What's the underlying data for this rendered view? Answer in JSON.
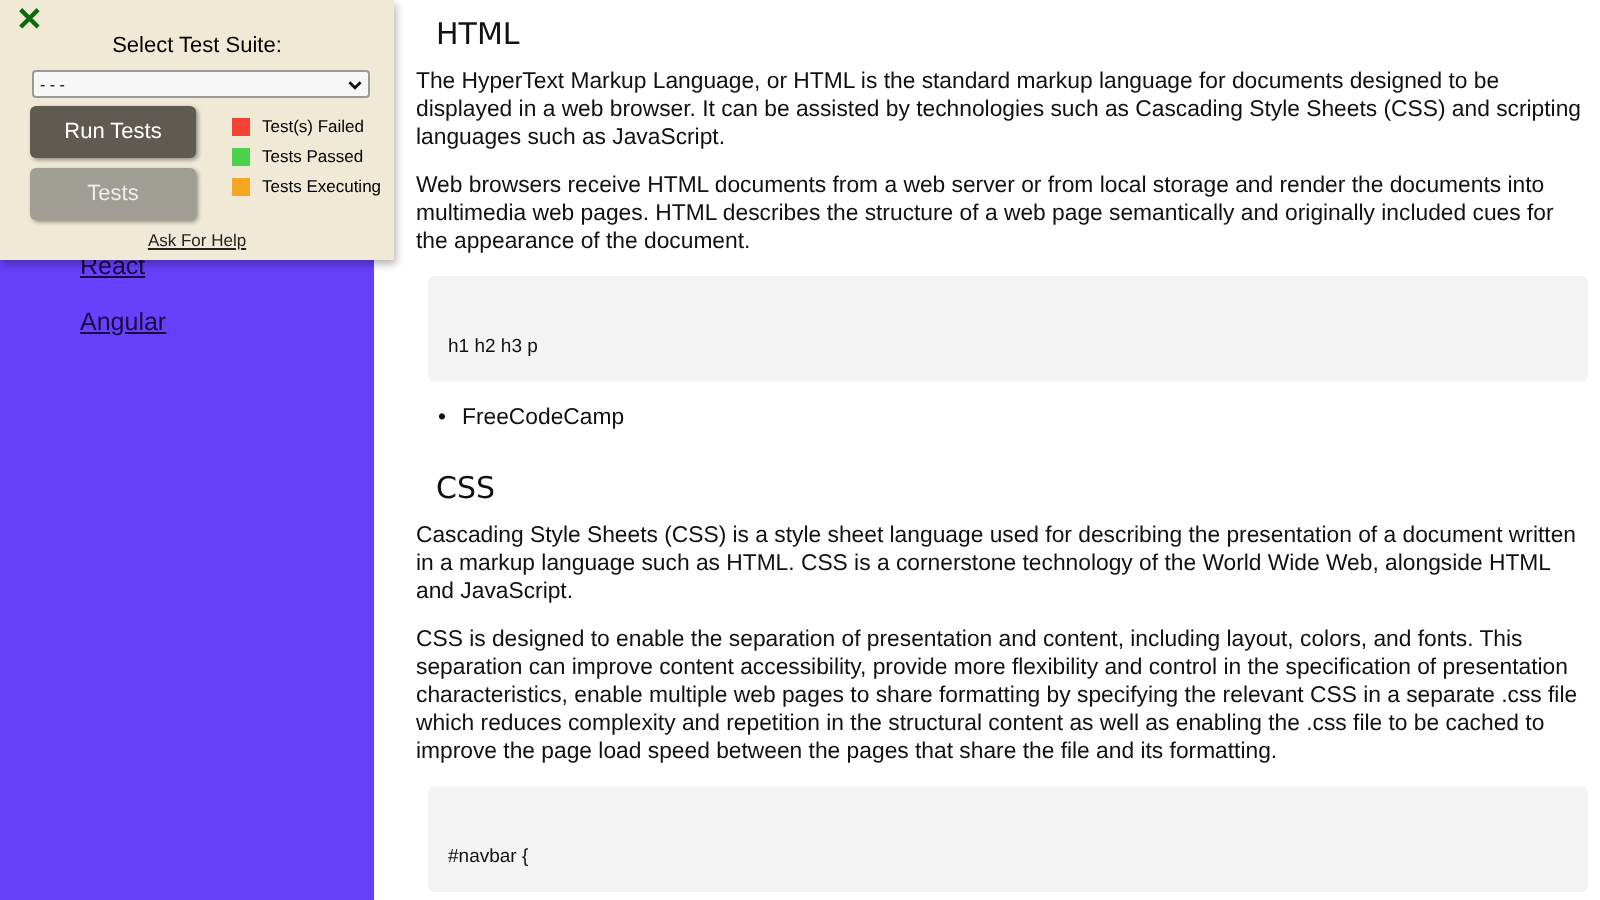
{
  "sidebar": {
    "items": [
      {
        "label": "React"
      },
      {
        "label": "Angular"
      }
    ]
  },
  "sections": [
    {
      "title": "HTML",
      "paragraphs": [
        "The HyperText Markup Language, or HTML is the standard markup language for documents designed to be displayed in a web browser. It can be assisted by technologies such as Cascading Style Sheets (CSS) and scripting languages such as JavaScript.",
        "Web browsers receive HTML documents from a web server or from local storage and render the documents into multimedia web pages. HTML describes the structure of a web page semantically and originally included cues for the appearance of the document."
      ],
      "code": "h1 h2 h3 p",
      "links": [
        {
          "marker": "•",
          "text": "FreeCodeCamp"
        }
      ]
    },
    {
      "title": "CSS",
      "paragraphs": [
        "Cascading Style Sheets (CSS) is a style sheet language used for describing the presentation of a document written in a markup language such as HTML. CSS is a cornerstone technology of the World Wide Web, alongside HTML and JavaScript.",
        "CSS is designed to enable the separation of presentation and content, including layout, colors, and fonts. This separation can improve content accessibility, provide more flexibility and control in the specification of presentation characteristics, enable multiple web pages to share formatting by specifying the relevant CSS in a separate .css file which reduces complexity and repetition in the structural content as well as enabling the .css file to be cached to improve the page load speed between the pages that share the file and its formatting."
      ],
      "code": "#navbar {"
    }
  ],
  "test_panel": {
    "close": "✕",
    "label": "Select Test Suite:",
    "suite": {
      "value": "- - -"
    },
    "buttons": [
      {
        "label": "Run Tests",
        "kind": "primary"
      },
      {
        "label": "Tests",
        "kind": "secondary"
      }
    ],
    "legend": [
      {
        "label": "Test(s) Failed",
        "color": "#f44336"
      },
      {
        "label": "Tests Passed",
        "color": "#4cd14c"
      },
      {
        "label": "Tests Executing",
        "color": "#f5a623"
      }
    ],
    "help": "Ask For Help"
  }
}
